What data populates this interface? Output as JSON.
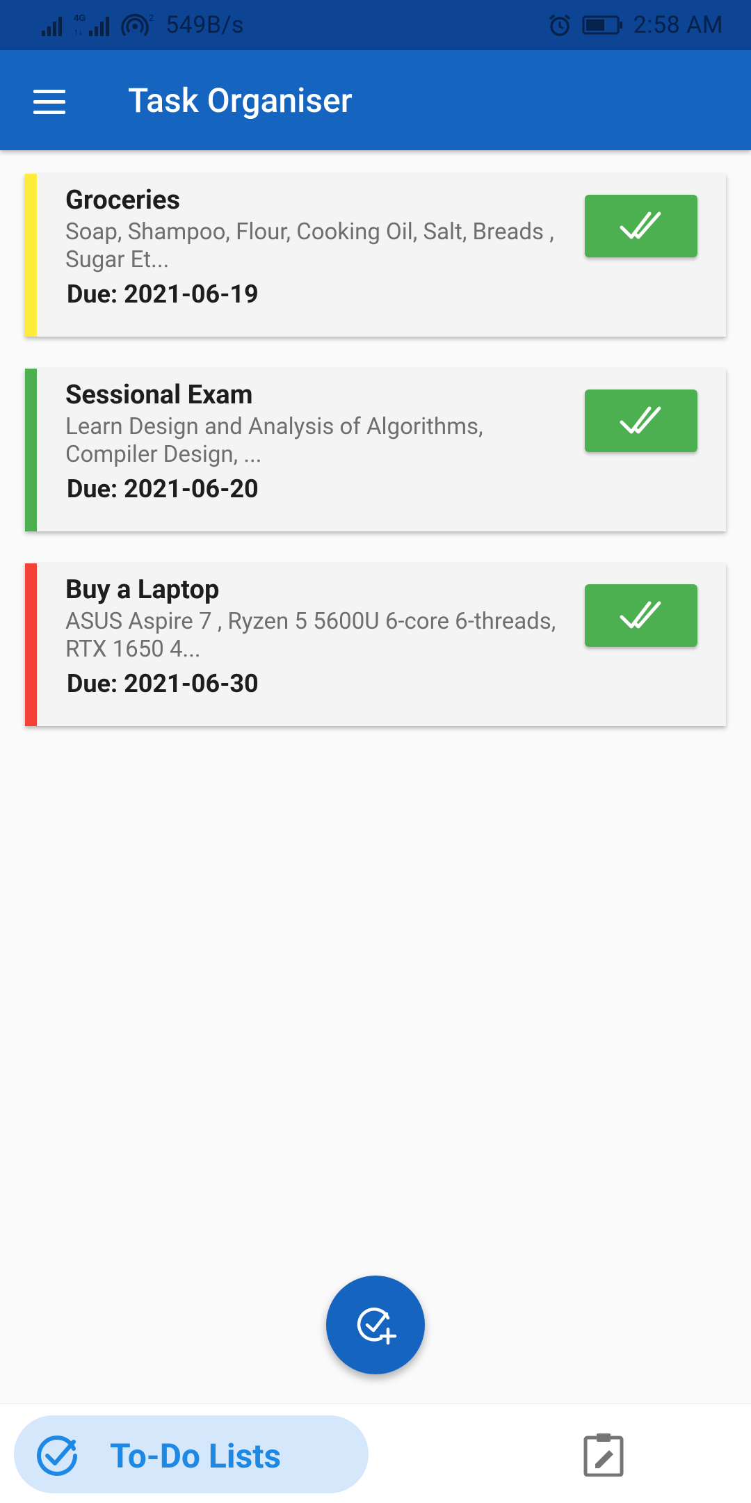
{
  "status_bar": {
    "network_speed": "549B/s",
    "time": "2:58 AM",
    "icons": [
      "signal-icon",
      "4g-signal-icon",
      "hotspot-icon",
      "alarm-icon",
      "battery-icon"
    ]
  },
  "app_bar": {
    "title": "Task Organiser",
    "menu_icon": "hamburger-menu-icon"
  },
  "tasks": [
    {
      "title": "Groceries",
      "description": "Soap, Shampoo, Flour, Cooking Oil, Salt, Breads , Sugar Et...",
      "due": "Due: 2021-06-19",
      "priority_color": "#ffeb3b"
    },
    {
      "title": "Sessional Exam",
      "description": "Learn Design and Analysis of Algorithms, Compiler Design, ...",
      "due": "Due: 2021-06-20",
      "priority_color": "#4caf50"
    },
    {
      "title": "Buy a Laptop",
      "description": "ASUS Aspire 7 , Ryzen 5 5600U 6-core 6-threads, RTX 1650 4...",
      "due": "Due: 2021-06-30",
      "priority_color": "#f44336"
    }
  ],
  "fab": {
    "icon": "add-task-icon"
  },
  "bottom_nav": {
    "active_label": "To-Do Lists",
    "active_icon": "check-circle-icon",
    "other_icon": "clipboard-edit-icon"
  },
  "colors": {
    "primary": "#1565c0",
    "status_bar": "#0d4494",
    "done_button": "#4caf50",
    "nav_active_bg": "#d4e7fb",
    "nav_active_text": "#1e88e5"
  }
}
